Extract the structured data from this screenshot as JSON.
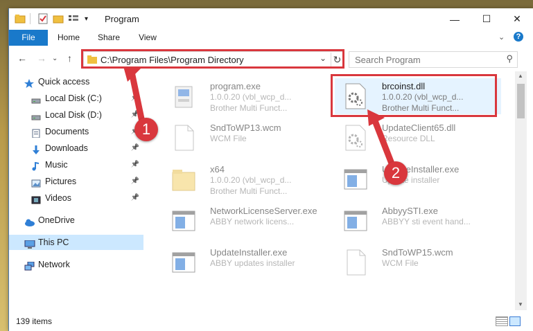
{
  "window": {
    "title": "Program"
  },
  "ribbon": {
    "tabs": [
      "File",
      "Home",
      "Share",
      "View"
    ]
  },
  "nav": {
    "address": "C:\\Program Files\\Program Directory",
    "search_placeholder": "Search Program"
  },
  "sidebar": {
    "items": [
      {
        "label": "Quick access",
        "icon": "star-icon"
      },
      {
        "label": "Local Disk (C:)",
        "icon": "drive-icon",
        "pinned": true
      },
      {
        "label": "Local Disk (D:)",
        "icon": "drive-icon",
        "pinned": true
      },
      {
        "label": "Documents",
        "icon": "document-icon",
        "pinned": true
      },
      {
        "label": "Downloads",
        "icon": "download-icon",
        "pinned": true
      },
      {
        "label": "Music",
        "icon": "music-icon",
        "pinned": true
      },
      {
        "label": "Pictures",
        "icon": "picture-icon",
        "pinned": true
      },
      {
        "label": "Videos",
        "icon": "video-icon",
        "pinned": true
      },
      {
        "label": "OneDrive",
        "icon": "cloud-icon"
      },
      {
        "label": "This PC",
        "icon": "computer-icon",
        "selected": true
      },
      {
        "label": "Network",
        "icon": "network-icon"
      }
    ]
  },
  "files": [
    {
      "name": "program.exe",
      "line1": "1.0.0.20 (vbl_wcp_d...",
      "line2": "Brother Multi Funct...",
      "icon": "installer-icon"
    },
    {
      "name": "brcoinst.dll",
      "line1": "1.0.0.20 (vbl_wcp_d...",
      "line2": "Brother Multi Funct...",
      "icon": "dll-icon",
      "highlighted": true
    },
    {
      "name": "SndToWP13.wcm",
      "line1": "WCM File",
      "line2": "",
      "icon": "blank-file-icon"
    },
    {
      "name": "UpdateClient65.dll",
      "line1": "Resource DLL",
      "line2": "",
      "icon": "dll-icon"
    },
    {
      "name": "x64",
      "line1": "1.0.0.20 (vbl_wcp_d...",
      "line2": "Brother Multi Funct...",
      "icon": "folder-icon"
    },
    {
      "name": "UpdateInstaller.exe",
      "line1": "Update installer",
      "line2": "",
      "icon": "app-window-icon"
    },
    {
      "name": "NetworkLicenseServer.exe",
      "line1": "ABBY network licens...",
      "line2": "",
      "icon": "app-window-icon"
    },
    {
      "name": "AbbyySTI.exe",
      "line1": "ABBYY sti event hand...",
      "line2": "",
      "icon": "app-window-icon"
    },
    {
      "name": "UpdateInstaller.exe",
      "line1": "ABBY updates installer",
      "line2": "",
      "icon": "app-window-icon"
    },
    {
      "name": "SndToWP15.wcm",
      "line1": "WCM File",
      "line2": "",
      "icon": "blank-file-icon"
    }
  ],
  "status": {
    "count": "139 items"
  },
  "annotations": {
    "badge1": "1",
    "badge2": "2"
  },
  "colors": {
    "accent": "#1979ca",
    "highlight": "#d9373d",
    "selected": "#cce8ff"
  }
}
